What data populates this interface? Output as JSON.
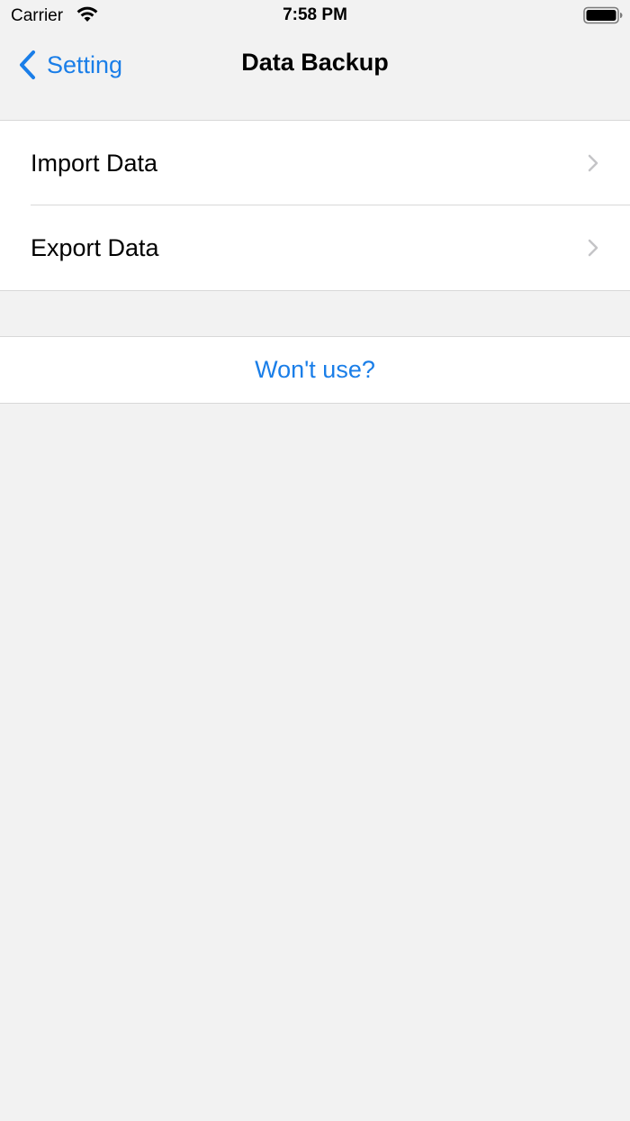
{
  "status_bar": {
    "carrier": "Carrier",
    "time": "7:58 PM",
    "wifi_icon": "wifi-icon",
    "battery_icon": "battery-icon"
  },
  "nav": {
    "back_label": "Setting",
    "title": "Data Backup"
  },
  "menu": {
    "items": [
      {
        "label": "Import Data"
      },
      {
        "label": "Export Data"
      }
    ]
  },
  "footer_action": {
    "label": "Won't use?"
  },
  "colors": {
    "accent": "#1a7ee8",
    "background": "#f2f2f2",
    "cell": "#ffffff",
    "separator": "#d8d8d8",
    "chevron": "#c4c4c7"
  }
}
